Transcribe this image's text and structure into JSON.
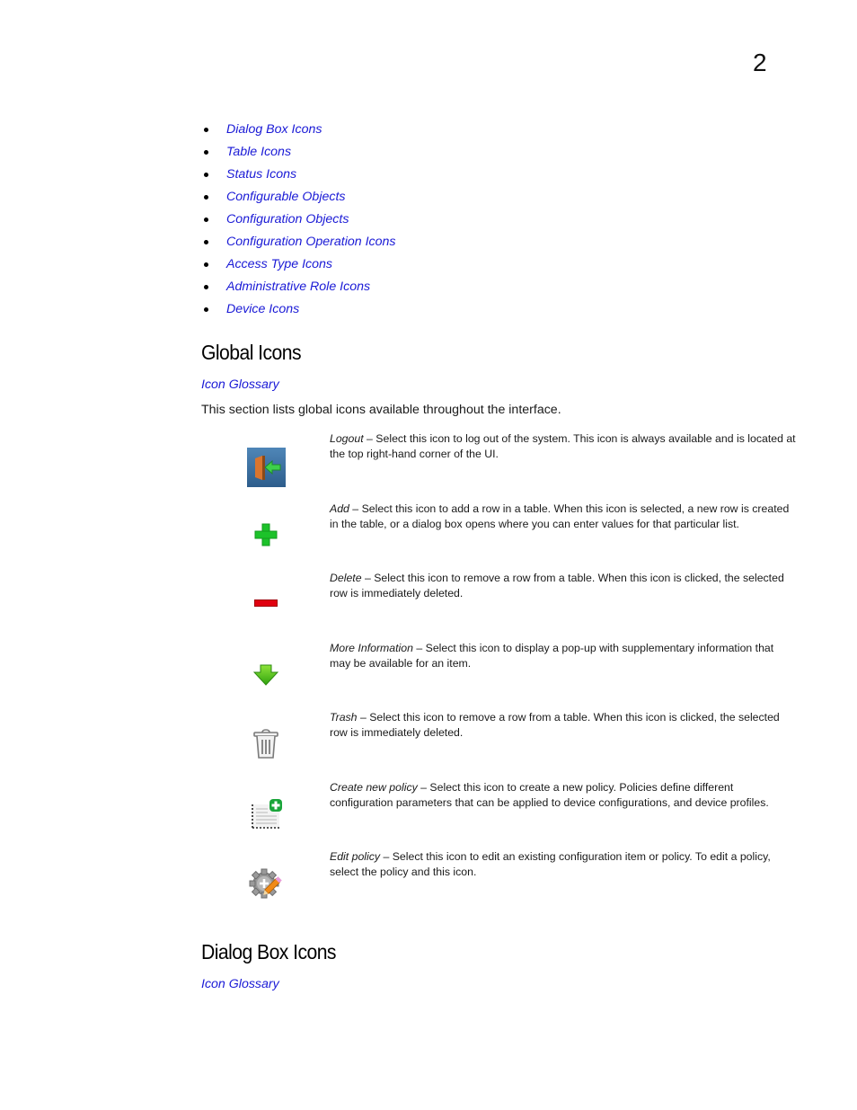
{
  "page": {
    "chapter_number": "2"
  },
  "toc": [
    "Dialog Box Icons",
    "Table Icons",
    "Status Icons",
    "Configurable Objects",
    "Configuration Objects",
    "Configuration Operation Icons",
    "Access Type Icons",
    "Administrative Role Icons",
    "Device Icons"
  ],
  "global_icons": {
    "title": "Global Icons",
    "glossary_link": "Icon Glossary",
    "intro": "This section lists global icons available throughout the interface.",
    "items": [
      {
        "icon": "logout-icon",
        "term": "Logout",
        "text": " – Select this icon to log out of the system. This icon is always available and is located at the top right-hand corner of the UI."
      },
      {
        "icon": "add-icon",
        "term": "Add",
        "text": " – Select this icon to add a row in a table. When this icon is selected, a new row is created in the table, or a dialog box opens where you can enter values for that particular list."
      },
      {
        "icon": "delete-icon",
        "term": "Delete",
        "text": " – Select this icon to remove a row from a table. When this icon is clicked, the selected row is immediately deleted."
      },
      {
        "icon": "more-information-icon",
        "term": "More Information",
        "text": " – Select this icon to display a pop-up with supplementary information that may be available for an item."
      },
      {
        "icon": "trash-icon",
        "term": "Trash",
        "text": " – Select this icon to remove a row from a table. When this icon is clicked, the selected row is immediately deleted."
      },
      {
        "icon": "create-policy-icon",
        "term": "Create new policy",
        "text": " – Select this icon to create a new policy. Policies define different configuration parameters that can be applied to device configurations, and device profiles."
      },
      {
        "icon": "edit-policy-icon",
        "term": "Edit policy",
        "text": " – Select this icon to edit an existing configuration item or policy. To edit a policy, select the policy and this icon."
      }
    ]
  },
  "dialog_box_icons": {
    "title": "Dialog Box Icons",
    "glossary_link": "Icon Glossary"
  }
}
